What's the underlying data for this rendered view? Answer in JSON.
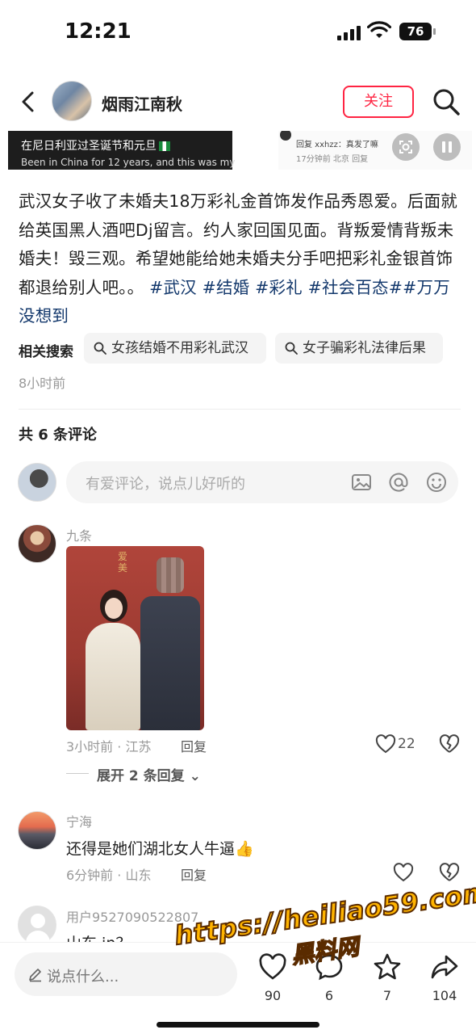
{
  "status_bar": {
    "time": "12:21",
    "battery": "76"
  },
  "header": {
    "author_name": "烟雨江南秋",
    "follow_label": "关注"
  },
  "media": {
    "caption_cn": "在尼日利亚过圣诞节和元旦",
    "caption_en": "Been in China for 12 years, and this was my",
    "reply_line1": "回复 xxhzz：真发了嘛",
    "reply_line2": "17分钟前 北京   回复"
  },
  "post": {
    "text": "武汉女子收了未婚夫18万彩礼金首饰发作品秀恩爱。后面就给英国黑人酒吧Dj留言。约人家回国见面。背叛爱情背叛未婚夫！毁三观。希望她能给她未婚夫分手吧把彩礼金银首饰都退给别人吧。。",
    "tags": [
      "#武汉",
      "#结婚",
      "#彩礼",
      "#社会百态#",
      "#万万没想到"
    ],
    "related_label": "相关搜索",
    "related": [
      "女孩结婚不用彩礼武汉",
      "女子骗彩礼法律后果"
    ],
    "time": "8小时前"
  },
  "comments_header": "共 6 条评论",
  "comment_input_placeholder": "有爱评论，说点儿好听的",
  "comments": [
    {
      "name": "九条",
      "text": "",
      "meta": "3小时前 · 江苏",
      "reply": "回复",
      "likes": "22",
      "expand": "展开 2 条回复"
    },
    {
      "name": "宁海",
      "text": "还得是她们湖北女人牛逼👍",
      "meta": "6分钟前 · 山东",
      "reply": "回复",
      "likes": ""
    },
    {
      "name": "用户9527090522807",
      "text": "山东 in？"
    }
  ],
  "bottom_bar": {
    "input_placeholder": "说点什么...",
    "likes": "90",
    "comments": "6",
    "stars": "7",
    "shares": "104"
  },
  "watermark": {
    "url": "https://heiliao59.com",
    "brand": "黑料网"
  }
}
